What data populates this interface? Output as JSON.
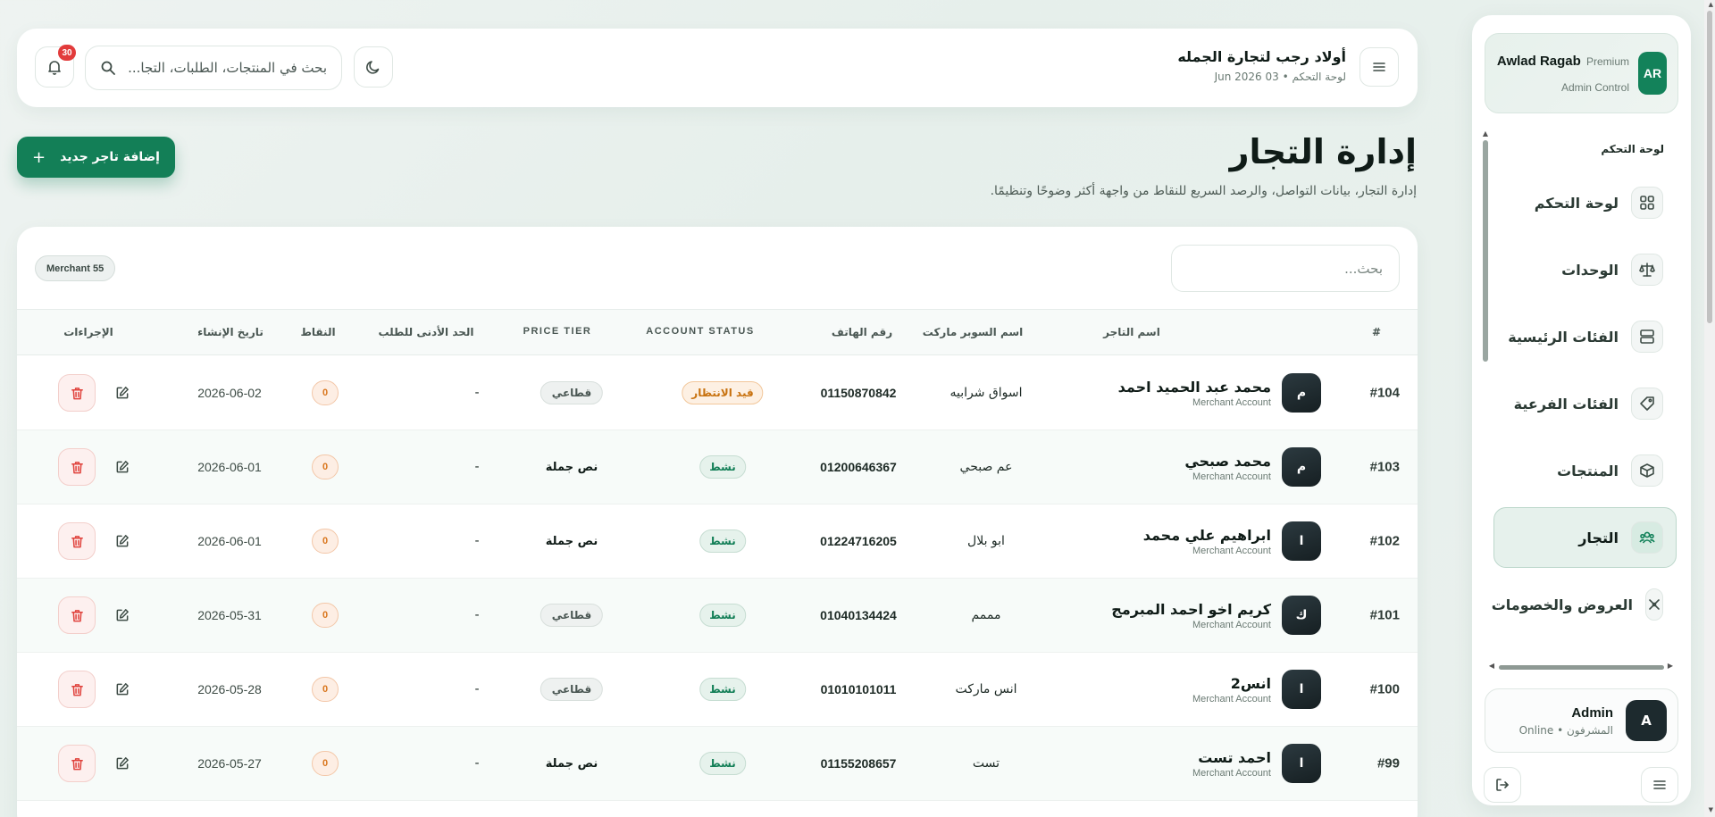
{
  "sidebar": {
    "profile": {
      "initials": "AR",
      "name": "Awlad Ragab",
      "tier": "Premium",
      "role": "Admin Control"
    },
    "nav_heading": "لوحة التحكم",
    "items": [
      {
        "label": "لوحة التحكم",
        "icon": "grid-icon"
      },
      {
        "label": "الوحدات",
        "icon": "scale-icon"
      },
      {
        "label": "الفئات الرئيسية",
        "icon": "layers-icon"
      },
      {
        "label": "الفئات الفرعية",
        "icon": "tag-icon"
      },
      {
        "label": "المنتجات",
        "icon": "box-icon"
      },
      {
        "label": "التجار",
        "icon": "users-icon",
        "active": true
      },
      {
        "label": "العروض والخصومات",
        "icon": "discount-icon"
      }
    ],
    "user": {
      "initials": "A",
      "name": "Admin",
      "status": "Online • المشرفون"
    }
  },
  "topbar": {
    "brand_title": "أولاد رجب لتجارة الجمله",
    "brand_sub": "لوحة التحكم • 03 Jun 2026",
    "search_placeholder": "بحث في المنتجات، الطلبات، التجا...",
    "notifications": "30"
  },
  "page": {
    "title": "إدارة التجار",
    "subtitle": "إدارة التجار، بيانات التواصل، والرصد السريع للنقاط من واجهة أكثر وضوحًا وتنظيمًا.",
    "add_button": "إضافة تاجر جديد",
    "add_plus": "+"
  },
  "table": {
    "search_placeholder": "بحث...",
    "count_label": "Merchant 55",
    "headers": {
      "id": "#",
      "merchant": "اسم التاجر",
      "market": "اسم السوبر ماركت",
      "phone": "رقم الهاتف",
      "status": "ACCOUNT STATUS",
      "tier": "PRICE TIER",
      "min_order": "الحد الأدنى للطلب",
      "points": "النقاط",
      "created": "تاريخ الإنشاء",
      "actions": "الإجراءات"
    },
    "rows": [
      {
        "id": "#104",
        "initial": "م",
        "name": "محمد عبد الحميد احمد",
        "sub": "Merchant Account",
        "market": "اسواق شرابيه",
        "phone": "01150870842",
        "status": "قيد الانتظار",
        "status_type": "pending",
        "tier": "قطاعي",
        "tier_type": "pill",
        "min_order": "-",
        "points": "0",
        "created": "2026-06-02"
      },
      {
        "id": "#103",
        "initial": "م",
        "name": "محمد صبحي",
        "sub": "Merchant Account",
        "market": "عم صبحي",
        "phone": "01200646367",
        "status": "نشط",
        "status_type": "active",
        "tier": "نص جملة",
        "tier_type": "text",
        "min_order": "-",
        "points": "0",
        "created": "2026-06-01"
      },
      {
        "id": "#102",
        "initial": "ا",
        "name": "ابراهيم علي محمد",
        "sub": "Merchant Account",
        "market": "ابو بلال",
        "phone": "01224716205",
        "status": "نشط",
        "status_type": "active",
        "tier": "نص جملة",
        "tier_type": "text",
        "min_order": "-",
        "points": "0",
        "created": "2026-06-01"
      },
      {
        "id": "#101",
        "initial": "ك",
        "name": "كريم اخو احمد المبرمج",
        "sub": "Merchant Account",
        "market": "مممم",
        "phone": "01040134424",
        "status": "نشط",
        "status_type": "active",
        "tier": "قطاعي",
        "tier_type": "pill",
        "min_order": "-",
        "points": "0",
        "created": "2026-05-31"
      },
      {
        "id": "#100",
        "initial": "ا",
        "name": "انس2",
        "sub": "Merchant Account",
        "market": "انس ماركت",
        "phone": "01010101011",
        "status": "نشط",
        "status_type": "active",
        "tier": "قطاعي",
        "tier_type": "pill",
        "min_order": "-",
        "points": "0",
        "created": "2026-05-28"
      },
      {
        "id": "#99",
        "initial": "ا",
        "name": "احمد تست",
        "sub": "Merchant Account",
        "market": "تست",
        "phone": "01155208657",
        "status": "نشط",
        "status_type": "active",
        "tier": "نص جملة",
        "tier_type": "text",
        "min_order": "-",
        "points": "0",
        "created": "2026-05-27"
      }
    ]
  },
  "colors": {
    "accent": "#137f57",
    "danger": "#e0423c",
    "pending": "#c8720f"
  }
}
